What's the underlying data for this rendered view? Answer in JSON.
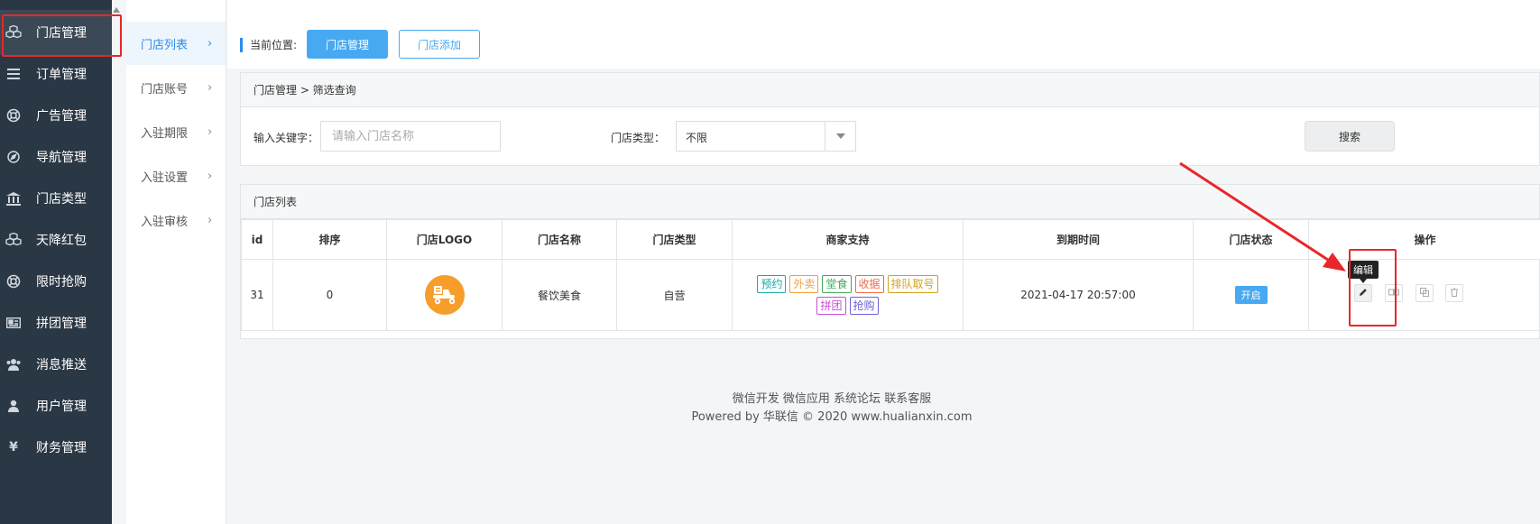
{
  "sidebar": {
    "items": [
      {
        "label": "门店管理",
        "icon": "cubes-icon"
      },
      {
        "label": "订单管理",
        "icon": "list-icon"
      },
      {
        "label": "广告管理",
        "icon": "lifebuoy-icon"
      },
      {
        "label": "导航管理",
        "icon": "compass-icon"
      },
      {
        "label": "门店类型",
        "icon": "bank-icon"
      },
      {
        "label": "天降红包",
        "icon": "cubes-icon"
      },
      {
        "label": "限时抢购",
        "icon": "lifebuoy-icon"
      },
      {
        "label": "拼团管理",
        "icon": "card-icon"
      },
      {
        "label": "消息推送",
        "icon": "users-icon"
      },
      {
        "label": "用户管理",
        "icon": "user-icon"
      },
      {
        "label": "财务管理",
        "icon": "yen-icon"
      }
    ]
  },
  "subnav": {
    "items": [
      {
        "label": "门店列表"
      },
      {
        "label": "门店账号"
      },
      {
        "label": "入驻期限"
      },
      {
        "label": "入驻设置"
      },
      {
        "label": "入驻审核"
      }
    ]
  },
  "crumb": {
    "current_label": "当前位置:",
    "primary_button": "门店管理",
    "secondary_button": "门店添加"
  },
  "filter": {
    "title": "门店管理 > 筛选查询",
    "keyword_label": "输入关键字：",
    "keyword_placeholder": "请输入门店名称",
    "type_label": "门店类型：",
    "type_value": "不限",
    "search_button": "搜索"
  },
  "list": {
    "title": "门店列表",
    "columns": [
      "id",
      "排序",
      "门店LOGO",
      "门店名称",
      "门店类型",
      "商家支持",
      "到期时间",
      "门店状态",
      "操作"
    ],
    "rows": [
      {
        "id": "31",
        "sort": "0",
        "name": "餐饮美食",
        "type": "自营",
        "support": [
          {
            "label": "预约",
            "color": "#1fa6a6"
          },
          {
            "label": "外卖",
            "color": "#f0a13a"
          },
          {
            "label": "堂食",
            "color": "#41a85f"
          },
          {
            "label": "收据",
            "color": "#f06a4a"
          },
          {
            "label": "排队取号",
            "color": "#d1a21c"
          },
          {
            "label": "拼团",
            "color": "#c84fd6"
          },
          {
            "label": "抢购",
            "color": "#6b62d8"
          }
        ],
        "expire": "2021-04-17 20:57:00",
        "status": "开启"
      }
    ],
    "tooltip": "编辑"
  },
  "footer": {
    "links": "微信开发 微信应用 系统论坛 联系客服",
    "powered": "Powered by 华联信 © 2020 www.hualianxin.com"
  },
  "colors": {
    "sidebar_bg": "#2a3744",
    "accent": "#47a9f2",
    "annotation_red": "#e8272a",
    "logo_orange": "#f69d2a"
  }
}
